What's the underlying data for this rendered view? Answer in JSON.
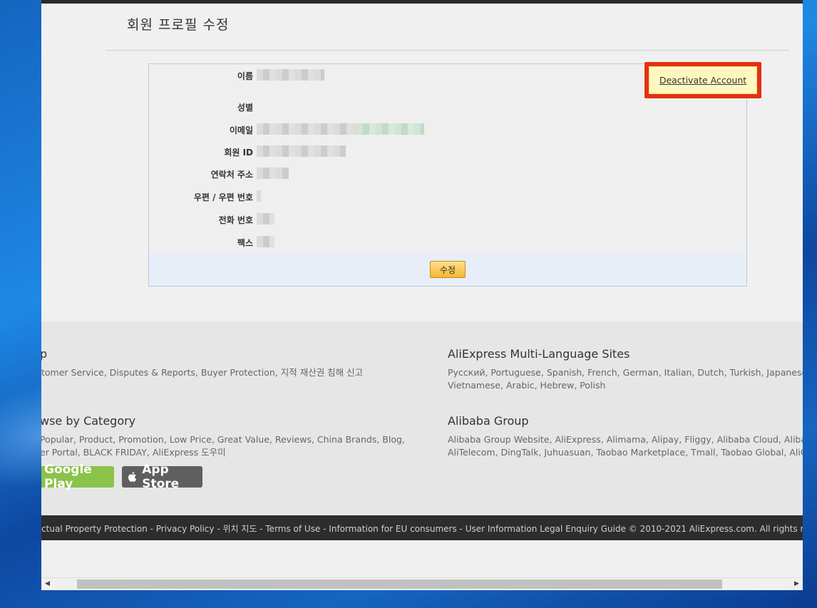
{
  "page": {
    "title": "회원 프로필 수정"
  },
  "profile": {
    "fields": [
      {
        "label": "이름"
      },
      {
        "label": "성별"
      },
      {
        "label": "이메일"
      },
      {
        "label": "회원 ID"
      },
      {
        "label": "연락처 주소"
      },
      {
        "label": "우편 / 우편 번호"
      },
      {
        "label": "전화 번호"
      },
      {
        "label": "팩스"
      }
    ],
    "edit_button": "수정",
    "deactivate_button": "Deactivate Account"
  },
  "footer": {
    "help": {
      "heading": "p",
      "links": "tomer Service, Disputes & Reports, Buyer Protection, 지적 재산권 침해 신고"
    },
    "multi_language": {
      "heading": "AliExpress Multi-Language Sites",
      "links_line1": "Русский, Portuguese, Spanish, French, German, Italian, Dutch, Turkish, Japanese, K",
      "links_line2": "Vietnamese, Arabic, Hebrew, Polish"
    },
    "browse": {
      "heading": "wse by Category",
      "links_line1": " Popular, Product, Promotion, Low Price, Great Value, Reviews, China Brands, Blog,",
      "links_line2": "er Portal, BLACK FRIDAY, AliExpress 도우미"
    },
    "alibaba": {
      "heading": "Alibaba Group",
      "links_line1": "Alibaba Group Website, AliExpress, Alimama, Alipay, Fliggy, Alibaba Cloud, Alibaba I",
      "links_line2": "AliTelecom, DingTalk, Juhuasuan, Taobao Marketplace, Tmall, Taobao Global, AliOS,"
    },
    "google_play": "Google Play",
    "app_store": "App Store",
    "bottom_links": "llectual Property Protection - Privacy Policy - 위치 지도 - Terms of Use - Information for EU consumers - User Information Legal Enquiry Guide © 2010-2021 AliExpress.com. All rights reserved"
  },
  "colors": {
    "highlight_border": "#e53012",
    "deactivate_bg": "#fff7c0",
    "edit_button": "#f7b733",
    "google_play": "#8bc34a",
    "app_store": "#5f5f5f"
  }
}
